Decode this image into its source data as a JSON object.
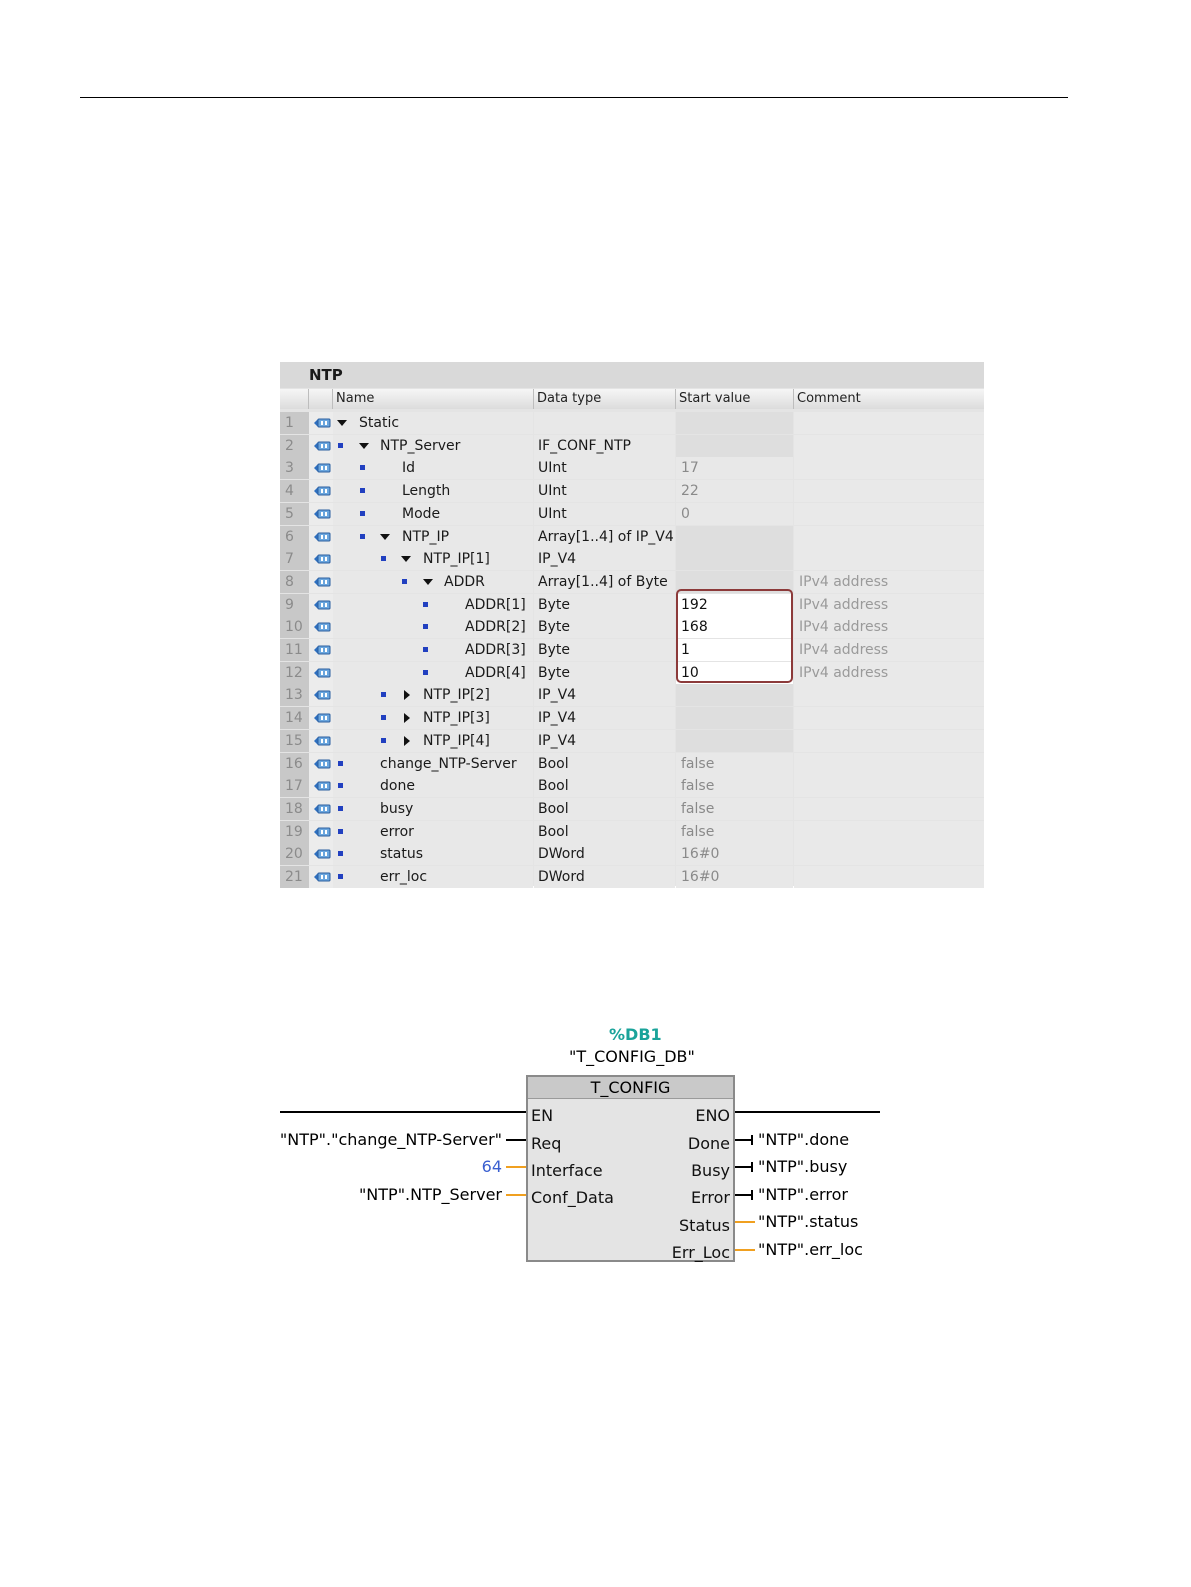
{
  "db": {
    "title": "NTP",
    "columns": {
      "name": "Name",
      "data_type": "Data type",
      "start_value": "Start value",
      "comment": "Comment"
    },
    "rows": [
      {
        "num": "1",
        "name": "Static",
        "type": "",
        "value": "",
        "comment": ""
      },
      {
        "num": "2",
        "name": "NTP_Server",
        "type": "IF_CONF_NTP",
        "value": "",
        "comment": ""
      },
      {
        "num": "3",
        "name": "Id",
        "type": "UInt",
        "value": "17",
        "comment": ""
      },
      {
        "num": "4",
        "name": "Length",
        "type": "UInt",
        "value": "22",
        "comment": ""
      },
      {
        "num": "5",
        "name": "Mode",
        "type": "UInt",
        "value": "0",
        "comment": ""
      },
      {
        "num": "6",
        "name": "NTP_IP",
        "type": "Array[1..4] of IP_V4",
        "value": "",
        "comment": ""
      },
      {
        "num": "7",
        "name": "NTP_IP[1]",
        "type": "IP_V4",
        "value": "",
        "comment": ""
      },
      {
        "num": "8",
        "name": "ADDR",
        "type": "Array[1..4] of Byte",
        "value": "",
        "comment": "IPv4 address"
      },
      {
        "num": "9",
        "name": "ADDR[1]",
        "type": "Byte",
        "value": "192",
        "comment": "IPv4 address"
      },
      {
        "num": "10",
        "name": "ADDR[2]",
        "type": "Byte",
        "value": "168",
        "comment": "IPv4 address"
      },
      {
        "num": "11",
        "name": "ADDR[3]",
        "type": "Byte",
        "value": "1",
        "comment": "IPv4 address"
      },
      {
        "num": "12",
        "name": "ADDR[4]",
        "type": "Byte",
        "value": "10",
        "comment": "IPv4 address"
      },
      {
        "num": "13",
        "name": "NTP_IP[2]",
        "type": "IP_V4",
        "value": "",
        "comment": ""
      },
      {
        "num": "14",
        "name": "NTP_IP[3]",
        "type": "IP_V4",
        "value": "",
        "comment": ""
      },
      {
        "num": "15",
        "name": "NTP_IP[4]",
        "type": "IP_V4",
        "value": "",
        "comment": ""
      },
      {
        "num": "16",
        "name": "change_NTP-Server",
        "type": "Bool",
        "value": "false",
        "comment": ""
      },
      {
        "num": "17",
        "name": "done",
        "type": "Bool",
        "value": "false",
        "comment": ""
      },
      {
        "num": "18",
        "name": "busy",
        "type": "Bool",
        "value": "false",
        "comment": ""
      },
      {
        "num": "19",
        "name": "error",
        "type": "Bool",
        "value": "false",
        "comment": ""
      },
      {
        "num": "20",
        "name": "status",
        "type": "DWord",
        "value": "16#0",
        "comment": ""
      },
      {
        "num": "21",
        "name": "err_loc",
        "type": "DWord",
        "value": "16#0",
        "comment": ""
      }
    ]
  },
  "block": {
    "db_number": "%DB1",
    "instance_name": "\"T_CONFIG_DB\"",
    "title": "T_CONFIG",
    "inputs": {
      "en": "EN",
      "req": "Req",
      "interface": "Interface",
      "conf_data": "Conf_Data"
    },
    "outputs": {
      "eno": "ENO",
      "done": "Done",
      "busy": "Busy",
      "error": "Error",
      "status": "Status",
      "err_loc": "Err_Loc"
    },
    "input_params": {
      "req": "\"NTP\".\"change_NTP-Server\"",
      "interface": "64",
      "conf_data": "\"NTP\".NTP_Server"
    },
    "output_params": {
      "done": "\"NTP\".done",
      "busy": "\"NTP\".busy",
      "error": "\"NTP\".error",
      "status": "\"NTP\".status",
      "err_loc": "\"NTP\".err_loc"
    },
    "colors": {
      "db_number": "#1aa39a",
      "constant": "#3a5fd0",
      "wire_orange": "#f0a020"
    }
  }
}
